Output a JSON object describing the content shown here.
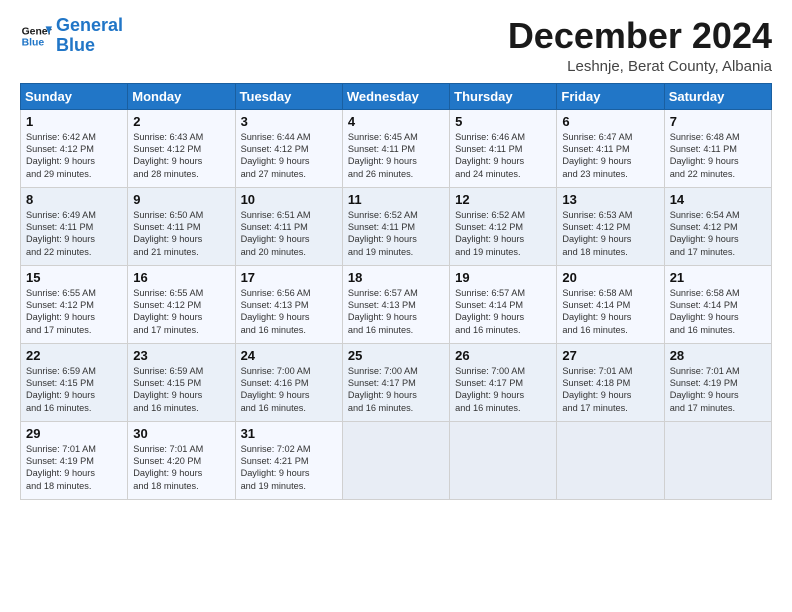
{
  "header": {
    "logo_line1": "General",
    "logo_line2": "Blue",
    "title": "December 2024",
    "location": "Leshnje, Berat County, Albania"
  },
  "days_of_week": [
    "Sunday",
    "Monday",
    "Tuesday",
    "Wednesday",
    "Thursday",
    "Friday",
    "Saturday"
  ],
  "weeks": [
    [
      {
        "day": 1,
        "lines": [
          "Sunrise: 6:42 AM",
          "Sunset: 4:12 PM",
          "Daylight: 9 hours",
          "and 29 minutes."
        ]
      },
      {
        "day": 2,
        "lines": [
          "Sunrise: 6:43 AM",
          "Sunset: 4:12 PM",
          "Daylight: 9 hours",
          "and 28 minutes."
        ]
      },
      {
        "day": 3,
        "lines": [
          "Sunrise: 6:44 AM",
          "Sunset: 4:12 PM",
          "Daylight: 9 hours",
          "and 27 minutes."
        ]
      },
      {
        "day": 4,
        "lines": [
          "Sunrise: 6:45 AM",
          "Sunset: 4:11 PM",
          "Daylight: 9 hours",
          "and 26 minutes."
        ]
      },
      {
        "day": 5,
        "lines": [
          "Sunrise: 6:46 AM",
          "Sunset: 4:11 PM",
          "Daylight: 9 hours",
          "and 24 minutes."
        ]
      },
      {
        "day": 6,
        "lines": [
          "Sunrise: 6:47 AM",
          "Sunset: 4:11 PM",
          "Daylight: 9 hours",
          "and 23 minutes."
        ]
      },
      {
        "day": 7,
        "lines": [
          "Sunrise: 6:48 AM",
          "Sunset: 4:11 PM",
          "Daylight: 9 hours",
          "and 22 minutes."
        ]
      }
    ],
    [
      {
        "day": 8,
        "lines": [
          "Sunrise: 6:49 AM",
          "Sunset: 4:11 PM",
          "Daylight: 9 hours",
          "and 22 minutes."
        ]
      },
      {
        "day": 9,
        "lines": [
          "Sunrise: 6:50 AM",
          "Sunset: 4:11 PM",
          "Daylight: 9 hours",
          "and 21 minutes."
        ]
      },
      {
        "day": 10,
        "lines": [
          "Sunrise: 6:51 AM",
          "Sunset: 4:11 PM",
          "Daylight: 9 hours",
          "and 20 minutes."
        ]
      },
      {
        "day": 11,
        "lines": [
          "Sunrise: 6:52 AM",
          "Sunset: 4:11 PM",
          "Daylight: 9 hours",
          "and 19 minutes."
        ]
      },
      {
        "day": 12,
        "lines": [
          "Sunrise: 6:52 AM",
          "Sunset: 4:12 PM",
          "Daylight: 9 hours",
          "and 19 minutes."
        ]
      },
      {
        "day": 13,
        "lines": [
          "Sunrise: 6:53 AM",
          "Sunset: 4:12 PM",
          "Daylight: 9 hours",
          "and 18 minutes."
        ]
      },
      {
        "day": 14,
        "lines": [
          "Sunrise: 6:54 AM",
          "Sunset: 4:12 PM",
          "Daylight: 9 hours",
          "and 17 minutes."
        ]
      }
    ],
    [
      {
        "day": 15,
        "lines": [
          "Sunrise: 6:55 AM",
          "Sunset: 4:12 PM",
          "Daylight: 9 hours",
          "and 17 minutes."
        ]
      },
      {
        "day": 16,
        "lines": [
          "Sunrise: 6:55 AM",
          "Sunset: 4:12 PM",
          "Daylight: 9 hours",
          "and 17 minutes."
        ]
      },
      {
        "day": 17,
        "lines": [
          "Sunrise: 6:56 AM",
          "Sunset: 4:13 PM",
          "Daylight: 9 hours",
          "and 16 minutes."
        ]
      },
      {
        "day": 18,
        "lines": [
          "Sunrise: 6:57 AM",
          "Sunset: 4:13 PM",
          "Daylight: 9 hours",
          "and 16 minutes."
        ]
      },
      {
        "day": 19,
        "lines": [
          "Sunrise: 6:57 AM",
          "Sunset: 4:14 PM",
          "Daylight: 9 hours",
          "and 16 minutes."
        ]
      },
      {
        "day": 20,
        "lines": [
          "Sunrise: 6:58 AM",
          "Sunset: 4:14 PM",
          "Daylight: 9 hours",
          "and 16 minutes."
        ]
      },
      {
        "day": 21,
        "lines": [
          "Sunrise: 6:58 AM",
          "Sunset: 4:14 PM",
          "Daylight: 9 hours",
          "and 16 minutes."
        ]
      }
    ],
    [
      {
        "day": 22,
        "lines": [
          "Sunrise: 6:59 AM",
          "Sunset: 4:15 PM",
          "Daylight: 9 hours",
          "and 16 minutes."
        ]
      },
      {
        "day": 23,
        "lines": [
          "Sunrise: 6:59 AM",
          "Sunset: 4:15 PM",
          "Daylight: 9 hours",
          "and 16 minutes."
        ]
      },
      {
        "day": 24,
        "lines": [
          "Sunrise: 7:00 AM",
          "Sunset: 4:16 PM",
          "Daylight: 9 hours",
          "and 16 minutes."
        ]
      },
      {
        "day": 25,
        "lines": [
          "Sunrise: 7:00 AM",
          "Sunset: 4:17 PM",
          "Daylight: 9 hours",
          "and 16 minutes."
        ]
      },
      {
        "day": 26,
        "lines": [
          "Sunrise: 7:00 AM",
          "Sunset: 4:17 PM",
          "Daylight: 9 hours",
          "and 16 minutes."
        ]
      },
      {
        "day": 27,
        "lines": [
          "Sunrise: 7:01 AM",
          "Sunset: 4:18 PM",
          "Daylight: 9 hours",
          "and 17 minutes."
        ]
      },
      {
        "day": 28,
        "lines": [
          "Sunrise: 7:01 AM",
          "Sunset: 4:19 PM",
          "Daylight: 9 hours",
          "and 17 minutes."
        ]
      }
    ],
    [
      {
        "day": 29,
        "lines": [
          "Sunrise: 7:01 AM",
          "Sunset: 4:19 PM",
          "Daylight: 9 hours",
          "and 18 minutes."
        ]
      },
      {
        "day": 30,
        "lines": [
          "Sunrise: 7:01 AM",
          "Sunset: 4:20 PM",
          "Daylight: 9 hours",
          "and 18 minutes."
        ]
      },
      {
        "day": 31,
        "lines": [
          "Sunrise: 7:02 AM",
          "Sunset: 4:21 PM",
          "Daylight: 9 hours",
          "and 19 minutes."
        ]
      },
      null,
      null,
      null,
      null
    ]
  ]
}
